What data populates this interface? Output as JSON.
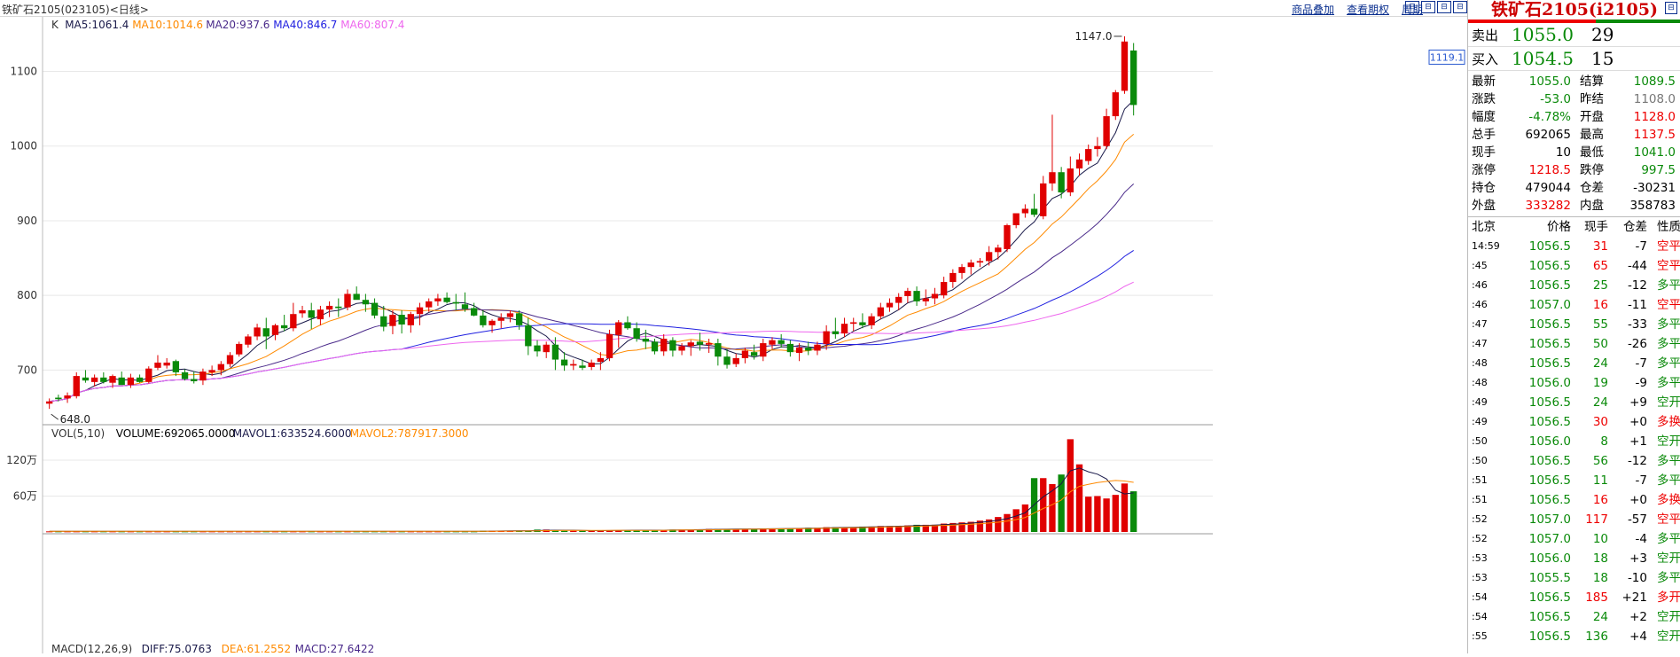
{
  "window": {
    "title": "铁矿石2105(023105)<日线>",
    "menu": [
      "商品叠加",
      "查看期权",
      "周期"
    ],
    "buttons": [
      "⊟",
      "⊟",
      "⊟",
      "⊟"
    ]
  },
  "colors": {
    "up": "#e00000",
    "down": "#0a8a0a",
    "ma5": "#1a1a4a",
    "ma10": "#ff8a00",
    "ma20": "#4a2a8a",
    "ma40": "#2020e0",
    "ma60": "#ee66ee"
  },
  "chart_data": [
    {
      "type": "candlestick",
      "title": "K",
      "legend": [
        {
          "label": "MA5:1061.4",
          "color": "#1a1a4a"
        },
        {
          "label": "MA10:1014.6",
          "color": "#ff8a00"
        },
        {
          "label": "MA20:937.6",
          "color": "#4a2a8a"
        },
        {
          "label": "MA40:846.7",
          "color": "#2020e0"
        },
        {
          "label": "MA60:807.4",
          "color": "#ee66ee"
        }
      ],
      "yticks": [
        700,
        800,
        900,
        1000,
        1100
      ],
      "ylim": [
        628,
        1160
      ],
      "annotations": {
        "high": "1147.0",
        "low": "648.0",
        "current_label": "1119.1"
      },
      "candles": [
        [
          655,
          662,
          648,
          658
        ],
        [
          663,
          667,
          658,
          661
        ],
        [
          662,
          670,
          656,
          666
        ],
        [
          665,
          697,
          662,
          692
        ],
        [
          690,
          700,
          683,
          686
        ],
        [
          684,
          694,
          678,
          690
        ],
        [
          690,
          697,
          682,
          684
        ],
        [
          683,
          694,
          676,
          692
        ],
        [
          690,
          698,
          684,
          680
        ],
        [
          680,
          695,
          676,
          690
        ],
        [
          690,
          694,
          683,
          684
        ],
        [
          684,
          705,
          682,
          702
        ],
        [
          703,
          720,
          700,
          710
        ],
        [
          706,
          716,
          702,
          710
        ],
        [
          712,
          714,
          692,
          697
        ],
        [
          697,
          701,
          686,
          688
        ],
        [
          688,
          698,
          682,
          685
        ],
        [
          686,
          702,
          680,
          698
        ],
        [
          697,
          706,
          692,
          700
        ],
        [
          700,
          712,
          693,
          708
        ],
        [
          708,
          724,
          704,
          720
        ],
        [
          721,
          738,
          718,
          735
        ],
        [
          734,
          748,
          730,
          745
        ],
        [
          745,
          762,
          740,
          757
        ],
        [
          756,
          770,
          728,
          745
        ],
        [
          747,
          762,
          740,
          760
        ],
        [
          760,
          774,
          752,
          756
        ],
        [
          756,
          790,
          752,
          775
        ],
        [
          776,
          786,
          770,
          780
        ],
        [
          780,
          790,
          755,
          770
        ],
        [
          768,
          786,
          760,
          781
        ],
        [
          781,
          792,
          771,
          786
        ],
        [
          785,
          796,
          771,
          783
        ],
        [
          784,
          808,
          780,
          802
        ],
        [
          802,
          812,
          798,
          794
        ],
        [
          794,
          802,
          778,
          788
        ],
        [
          790,
          796,
          769,
          773
        ],
        [
          772,
          786,
          752,
          758
        ],
        [
          759,
          780,
          748,
          774
        ],
        [
          774,
          780,
          749,
          761
        ],
        [
          760,
          778,
          750,
          775
        ],
        [
          775,
          790,
          760,
          784
        ],
        [
          784,
          796,
          778,
          792
        ],
        [
          792,
          802,
          786,
          796
        ],
        [
          797,
          804,
          789,
          791
        ],
        [
          791,
          802,
          780,
          789
        ],
        [
          788,
          804,
          778,
          782
        ],
        [
          783,
          790,
          772,
          773
        ],
        [
          773,
          780,
          757,
          760
        ],
        [
          760,
          768,
          750,
          766
        ],
        [
          766,
          776,
          756,
          770
        ],
        [
          771,
          780,
          764,
          776
        ],
        [
          776,
          780,
          754,
          760
        ],
        [
          760,
          770,
          720,
          732
        ],
        [
          733,
          740,
          718,
          725
        ],
        [
          724,
          738,
          716,
          734
        ],
        [
          734,
          744,
          700,
          714
        ],
        [
          714,
          724,
          699,
          706
        ],
        [
          706,
          714,
          700,
          708
        ],
        [
          706,
          714,
          700,
          703
        ],
        [
          704,
          714,
          700,
          710
        ],
        [
          711,
          724,
          700,
          716
        ],
        [
          716,
          754,
          712,
          748
        ],
        [
          747,
          767,
          730,
          764
        ],
        [
          764,
          772,
          754,
          756
        ],
        [
          756,
          764,
          738,
          742
        ],
        [
          742,
          754,
          728,
          738
        ],
        [
          738,
          742,
          721,
          725
        ],
        [
          725,
          748,
          719,
          742
        ],
        [
          740,
          744,
          718,
          726
        ],
        [
          726,
          736,
          720,
          732
        ],
        [
          732,
          740,
          719,
          737
        ],
        [
          738,
          750,
          726,
          734
        ],
        [
          734,
          742,
          723,
          736
        ],
        [
          736,
          742,
          706,
          718
        ],
        [
          718,
          728,
          702,
          707
        ],
        [
          708,
          722,
          704,
          716
        ],
        [
          716,
          730,
          709,
          726
        ],
        [
          724,
          734,
          714,
          719
        ],
        [
          718,
          742,
          712,
          736
        ],
        [
          734,
          744,
          728,
          740
        ],
        [
          740,
          748,
          730,
          735
        ],
        [
          735,
          740,
          718,
          724
        ],
        [
          723,
          736,
          712,
          730
        ],
        [
          730,
          738,
          720,
          726
        ],
        [
          726,
          738,
          720,
          734
        ],
        [
          735,
          760,
          727,
          752
        ],
        [
          752,
          770,
          742,
          748
        ],
        [
          749,
          770,
          744,
          762
        ],
        [
          762,
          770,
          752,
          764
        ],
        [
          764,
          776,
          756,
          760
        ],
        [
          760,
          776,
          755,
          772
        ],
        [
          772,
          790,
          768,
          784
        ],
        [
          784,
          796,
          778,
          790
        ],
        [
          790,
          803,
          780,
          798
        ],
        [
          799,
          810,
          790,
          806
        ],
        [
          806,
          812,
          786,
          792
        ],
        [
          792,
          808,
          786,
          796
        ],
        [
          796,
          810,
          788,
          802
        ],
        [
          800,
          825,
          796,
          818
        ],
        [
          818,
          835,
          810,
          830
        ],
        [
          830,
          842,
          822,
          838
        ],
        [
          838,
          848,
          828,
          844
        ],
        [
          844,
          850,
          838,
          846
        ],
        [
          846,
          866,
          840,
          858
        ],
        [
          858,
          868,
          848,
          864
        ],
        [
          862,
          896,
          858,
          894
        ],
        [
          894,
          908,
          890,
          910
        ],
        [
          910,
          922,
          904,
          916
        ],
        [
          916,
          936,
          905,
          908
        ],
        [
          906,
          960,
          902,
          950
        ],
        [
          950,
          1042,
          940,
          965
        ],
        [
          965,
          972,
          930,
          938
        ],
        [
          938,
          986,
          933,
          970
        ],
        [
          970,
          990,
          960,
          982
        ],
        [
          980,
          1002,
          975,
          996
        ],
        [
          996,
          1012,
          986,
          1000
        ],
        [
          1000,
          1050,
          996,
          1040
        ],
        [
          1040,
          1075,
          1035,
          1072
        ],
        [
          1074,
          1147,
          1070,
          1140
        ],
        [
          1128,
          1138,
          1041,
          1055
        ]
      ]
    },
    {
      "type": "bar",
      "title": "VOL(5,10)",
      "legend": [
        {
          "label": "VOLUME:692065.0000",
          "color": "#000000"
        },
        {
          "label": "MAVOL1:633524.6000",
          "color": "#1a1a4a"
        },
        {
          "label": "MAVOL2:787917.3000",
          "color": "#ff8a00"
        }
      ],
      "yticks": [
        {
          "v": 60,
          "label": "60万"
        },
        {
          "v": 120,
          "label": "120万"
        }
      ],
      "ylim": [
        0,
        160
      ],
      "unit": "万",
      "values": [
        1,
        1,
        1,
        1,
        1,
        1,
        1,
        1,
        1,
        1,
        1,
        1,
        1,
        1,
        1,
        1,
        1,
        1,
        1,
        1,
        1,
        1,
        1,
        1,
        1,
        1,
        1,
        1,
        1,
        1,
        1,
        1,
        1,
        1,
        1,
        1,
        1,
        1,
        1,
        1,
        1,
        1,
        1,
        1,
        1,
        1,
        1,
        1,
        2,
        2,
        2,
        2,
        2,
        2,
        4,
        4,
        3,
        2,
        2,
        2,
        2,
        3,
        3,
        3,
        3,
        3,
        3,
        3,
        3,
        4,
        4,
        4,
        4,
        5,
        5,
        5,
        5,
        5,
        5,
        6,
        6,
        6,
        6,
        6,
        7,
        7,
        8,
        8,
        8,
        8,
        9,
        9,
        10,
        10,
        10,
        11,
        12,
        12,
        12,
        14,
        15,
        16,
        17,
        19,
        21,
        25,
        30,
        38,
        46,
        90,
        90,
        80,
        96,
        155,
        113,
        59,
        60,
        56,
        62,
        81,
        68
      ]
    },
    {
      "type": "line",
      "title": "MACD(12,26,9)",
      "legend": [
        {
          "label": "DIFF:75.0763",
          "color": "#1a1a4a"
        },
        {
          "label": "DEA:61.2552",
          "color": "#ff8a00"
        },
        {
          "label": "MACD:27.6422",
          "color": "#4a2a8a"
        }
      ]
    }
  ],
  "quote": {
    "title": "铁矿石2105(i2105)",
    "sell": {
      "label": "卖出",
      "price": "1055.0",
      "qty": "29"
    },
    "buy": {
      "label": "买入",
      "price": "1054.5",
      "qty": "15"
    },
    "rows": [
      {
        "k": "最新",
        "v": "1055.0",
        "vc": "green",
        "k2": "结算",
        "v2": "1089.5",
        "v2c": "green"
      },
      {
        "k": "涨跌",
        "v": "-53.0",
        "vc": "green",
        "k2": "昨结",
        "v2": "1108.0",
        "v2c": "gray"
      },
      {
        "k": "幅度",
        "v": "-4.78%",
        "vc": "green",
        "k2": "开盘",
        "v2": "1128.0",
        "v2c": "red"
      },
      {
        "k": "总手",
        "v": "692065",
        "vc": "",
        "k2": "最高",
        "v2": "1137.5",
        "v2c": "red"
      },
      {
        "k": "现手",
        "v": "10",
        "vc": "",
        "k2": "最低",
        "v2": "1041.0",
        "v2c": "green"
      },
      {
        "k": "涨停",
        "v": "1218.5",
        "vc": "red",
        "k2": "跌停",
        "v2": "997.5",
        "v2c": "green"
      },
      {
        "k": "持仓",
        "v": "479044",
        "vc": "",
        "k2": "仓差",
        "v2": "-30231",
        "v2c": ""
      },
      {
        "k": "外盘",
        "v": "333282",
        "vc": "red",
        "k2": "内盘",
        "v2": "358783",
        "v2c": ""
      }
    ]
  },
  "ticks": {
    "headers": [
      "北京",
      "价格",
      "现手",
      "仓差",
      "性质"
    ],
    "rows": [
      {
        "t": "14:59",
        "p": "1056.5",
        "q": "31",
        "qc": "red",
        "d": "-7",
        "n": "空平",
        "nc": "red"
      },
      {
        "t": ":45",
        "p": "1056.5",
        "q": "65",
        "qc": "red",
        "d": "-44",
        "n": "空平",
        "nc": "red"
      },
      {
        "t": ":46",
        "p": "1056.5",
        "q": "25",
        "qc": "green",
        "d": "-12",
        "n": "多平",
        "nc": "green"
      },
      {
        "t": ":46",
        "p": "1057.0",
        "q": "16",
        "qc": "red",
        "d": "-11",
        "n": "空平",
        "nc": "red"
      },
      {
        "t": ":47",
        "p": "1056.5",
        "q": "55",
        "qc": "green",
        "d": "-33",
        "n": "多平",
        "nc": "green"
      },
      {
        "t": ":47",
        "p": "1056.5",
        "q": "50",
        "qc": "green",
        "d": "-26",
        "n": "多平",
        "nc": "green"
      },
      {
        "t": ":48",
        "p": "1056.5",
        "q": "24",
        "qc": "green",
        "d": "-7",
        "n": "多平",
        "nc": "green"
      },
      {
        "t": ":48",
        "p": "1056.0",
        "q": "19",
        "qc": "green",
        "d": "-9",
        "n": "多平",
        "nc": "green"
      },
      {
        "t": ":49",
        "p": "1056.5",
        "q": "24",
        "qc": "green",
        "d": "+9",
        "n": "空开",
        "nc": "green"
      },
      {
        "t": ":49",
        "p": "1056.5",
        "q": "30",
        "qc": "red",
        "d": "+0",
        "n": "多换",
        "nc": "red"
      },
      {
        "t": ":50",
        "p": "1056.0",
        "q": "8",
        "qc": "green",
        "d": "+1",
        "n": "空开",
        "nc": "green"
      },
      {
        "t": ":50",
        "p": "1056.5",
        "q": "56",
        "qc": "green",
        "d": "-12",
        "n": "多平",
        "nc": "green"
      },
      {
        "t": ":51",
        "p": "1056.5",
        "q": "11",
        "qc": "green",
        "d": "-7",
        "n": "多平",
        "nc": "green"
      },
      {
        "t": ":51",
        "p": "1056.5",
        "q": "16",
        "qc": "red",
        "d": "+0",
        "n": "多换",
        "nc": "red"
      },
      {
        "t": ":52",
        "p": "1057.0",
        "q": "117",
        "qc": "red",
        "d": "-57",
        "n": "空平",
        "nc": "red"
      },
      {
        "t": ":52",
        "p": "1057.0",
        "q": "10",
        "qc": "green",
        "d": "-4",
        "n": "多平",
        "nc": "green"
      },
      {
        "t": ":53",
        "p": "1056.0",
        "q": "18",
        "qc": "green",
        "d": "+3",
        "n": "空开",
        "nc": "green"
      },
      {
        "t": ":53",
        "p": "1055.5",
        "q": "18",
        "qc": "green",
        "d": "-10",
        "n": "多平",
        "nc": "green"
      },
      {
        "t": ":54",
        "p": "1056.5",
        "q": "185",
        "qc": "red",
        "d": "+21",
        "n": "多开",
        "nc": "red"
      },
      {
        "t": ":54",
        "p": "1056.5",
        "q": "24",
        "qc": "green",
        "d": "+2",
        "n": "空开",
        "nc": "green"
      },
      {
        "t": ":55",
        "p": "1056.5",
        "q": "136",
        "qc": "green",
        "d": "+4",
        "n": "空开",
        "nc": "green"
      }
    ]
  }
}
